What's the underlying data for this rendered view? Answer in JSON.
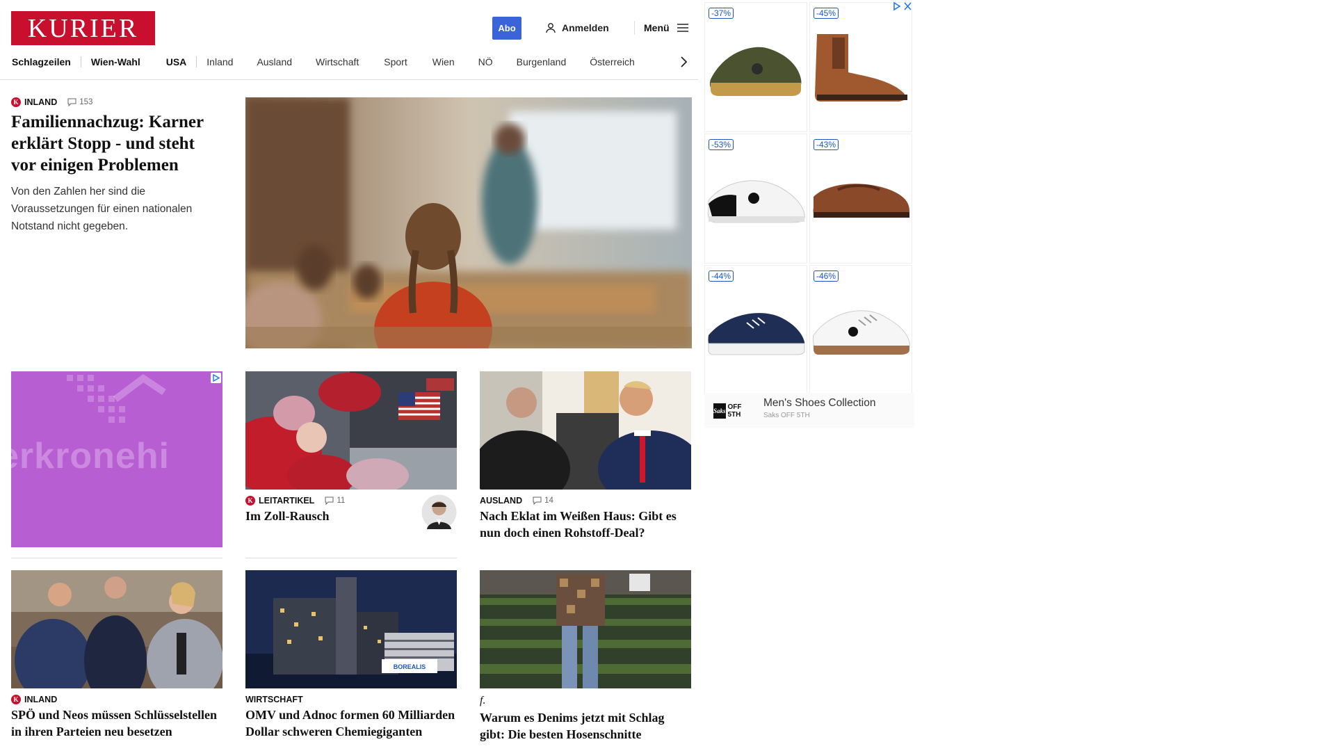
{
  "header": {
    "logo": "KURIER",
    "abo_label": "Abo",
    "login_label": "Anmelden",
    "menu_label": "Menü",
    "nav": [
      "Schlagzeilen",
      "Wien-Wahl",
      "USA",
      "Inland",
      "Ausland",
      "Wirtschaft",
      "Sport",
      "Wien",
      "NÖ",
      "Burgenland",
      "Österreich"
    ]
  },
  "lead": {
    "category": "INLAND",
    "comments": "153",
    "title": "Familiennachzug: Karner erklärt Stopp - und steht vor einigen Problemen",
    "teaser": "Von den Zahlen her sind die Voraussetzungen für einen nationalen Notstand nicht gegeben."
  },
  "ad_left": {
    "word": "erkronehi"
  },
  "cards": [
    {
      "category": "LEITARTIKEL",
      "comments": "11",
      "title": "Im Zoll-Rausch"
    },
    {
      "category": "AUSLAND",
      "comments": "14",
      "title": "Nach Eklat im Weißen Haus: Gibt es nun doch einen Rohstoff-Deal?"
    },
    {
      "category": "INLAND",
      "title": "SPÖ und Neos müssen Schlüsselstellen in ihren Parteien neu besetzen"
    },
    {
      "category": "WIRTSCHAFT",
      "title": "OMV und Adnoc formen 60 Milliarden Dollar schweren Chemiegiganten"
    },
    {
      "category": "f.",
      "title": "Warum es Denims jetzt mit Schlag gibt: Die besten Hosenschnitte"
    }
  ],
  "borealis_label": "BOREALIS",
  "ad_right": {
    "discounts": [
      "-37%",
      "-45%",
      "-53%",
      "-43%",
      "-44%",
      "-46%"
    ],
    "brand_title": "Men's Shoes Collection",
    "brand_sub": "Saks OFF 5TH",
    "brand_logo_mark": "Saks",
    "brand_logo_text": "OFF 5TH"
  },
  "colors": {
    "brand_red": "#c8102e",
    "abo_blue": "#3a64d8",
    "ad_purple": "#b85ed3",
    "ad_blue": "#1a55c7"
  }
}
